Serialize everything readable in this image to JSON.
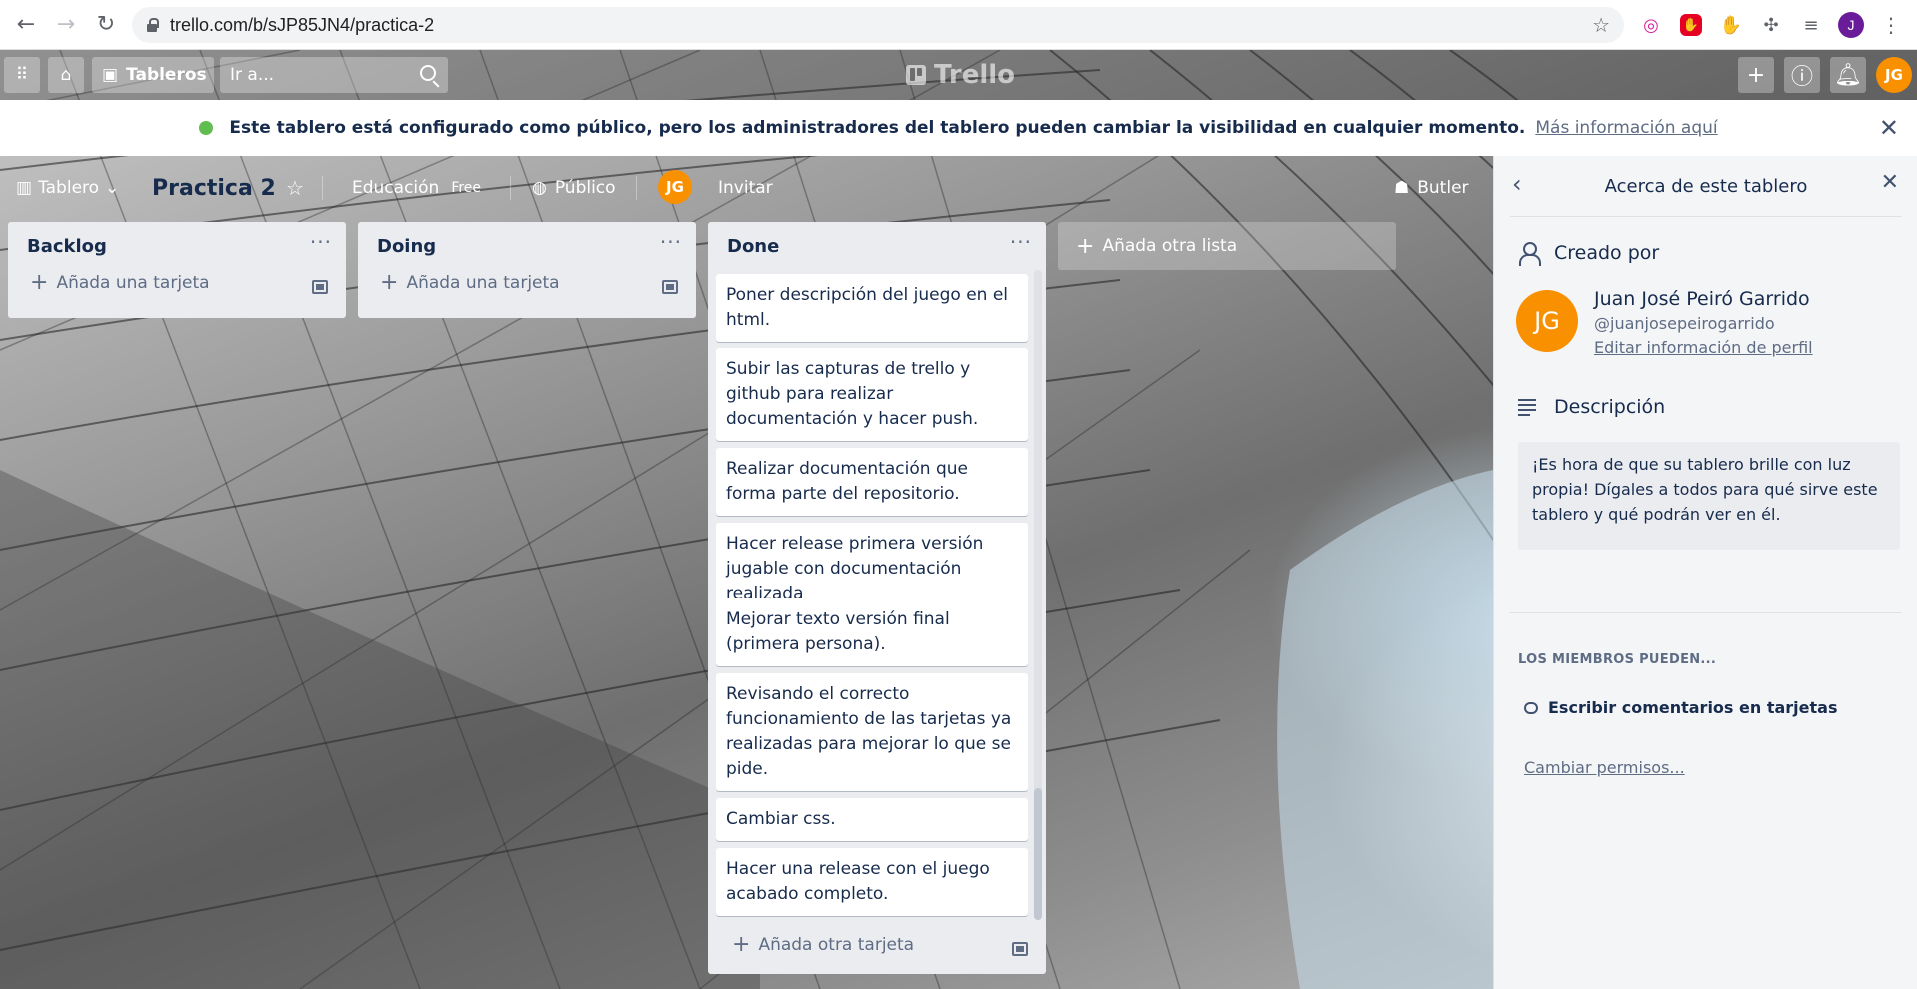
{
  "browser": {
    "url": "trello.com/b/sJP85JN4/practica-2",
    "profile_initial": "J"
  },
  "header": {
    "boards_label": "Tableros",
    "search_placeholder": "Ir a...",
    "logo_text": "Trello",
    "avatar_initials": "JG"
  },
  "notice": {
    "message": "Este tablero está configurado como público, pero los administradores del tablero pueden cambiar la visibilidad en cualquier momento.",
    "link": "Más información aquí"
  },
  "board": {
    "menu_label": "Tablero",
    "title": "Practica 2",
    "team": "Educación",
    "team_badge": "Free",
    "visibility": "Público",
    "member_initials": "JG",
    "invite_label": "Invitar",
    "butler_label": "Butler"
  },
  "lists": [
    {
      "title": "Backlog",
      "add_card_label": "Añada una tarjeta",
      "cards": []
    },
    {
      "title": "Doing",
      "add_card_label": "Añada una tarjeta",
      "cards": []
    },
    {
      "title": "Done",
      "add_card_label": "Añada otra tarjeta",
      "cards": [
        "Poner descripción del juego en el html.",
        "Subir las capturas de trello y github para realizar documentación y hacer push.",
        "Realizar documentación que forma parte del repositorio.",
        "Hacer release primera versión jugable con documentación realizada",
        "Mejorar texto versión final (primera persona).",
        "Revisando el correcto funcionamiento de las tarjetas ya realizadas para mejorar lo que se pide.",
        "Cambiar css.",
        "Hacer una release con el juego acabado completo."
      ]
    }
  ],
  "add_list_label": "Añada otra lista",
  "sidebar": {
    "title": "Acerca de este tablero",
    "created_by_label": "Creado por",
    "creator_initials": "JG",
    "creator_name": "Juan José Peiró Garrido",
    "creator_username": "@juanjosepeirogarrido",
    "edit_profile_link": "Editar información de perfil",
    "description_label": "Descripción",
    "description_text": "¡Es hora de que su tablero brille con luz propia! Dígales a todos para qué sirve este tablero y qué podrán ver en él.",
    "members_can_label": "Los miembros pueden...",
    "permission_item": "Escribir comentarios en tarjetas",
    "change_permissions_link": "Cambiar permisos..."
  },
  "colors": {
    "avatar": "#f99000",
    "list_bg": "#ebecf0",
    "public_green": "#61bd4f"
  }
}
